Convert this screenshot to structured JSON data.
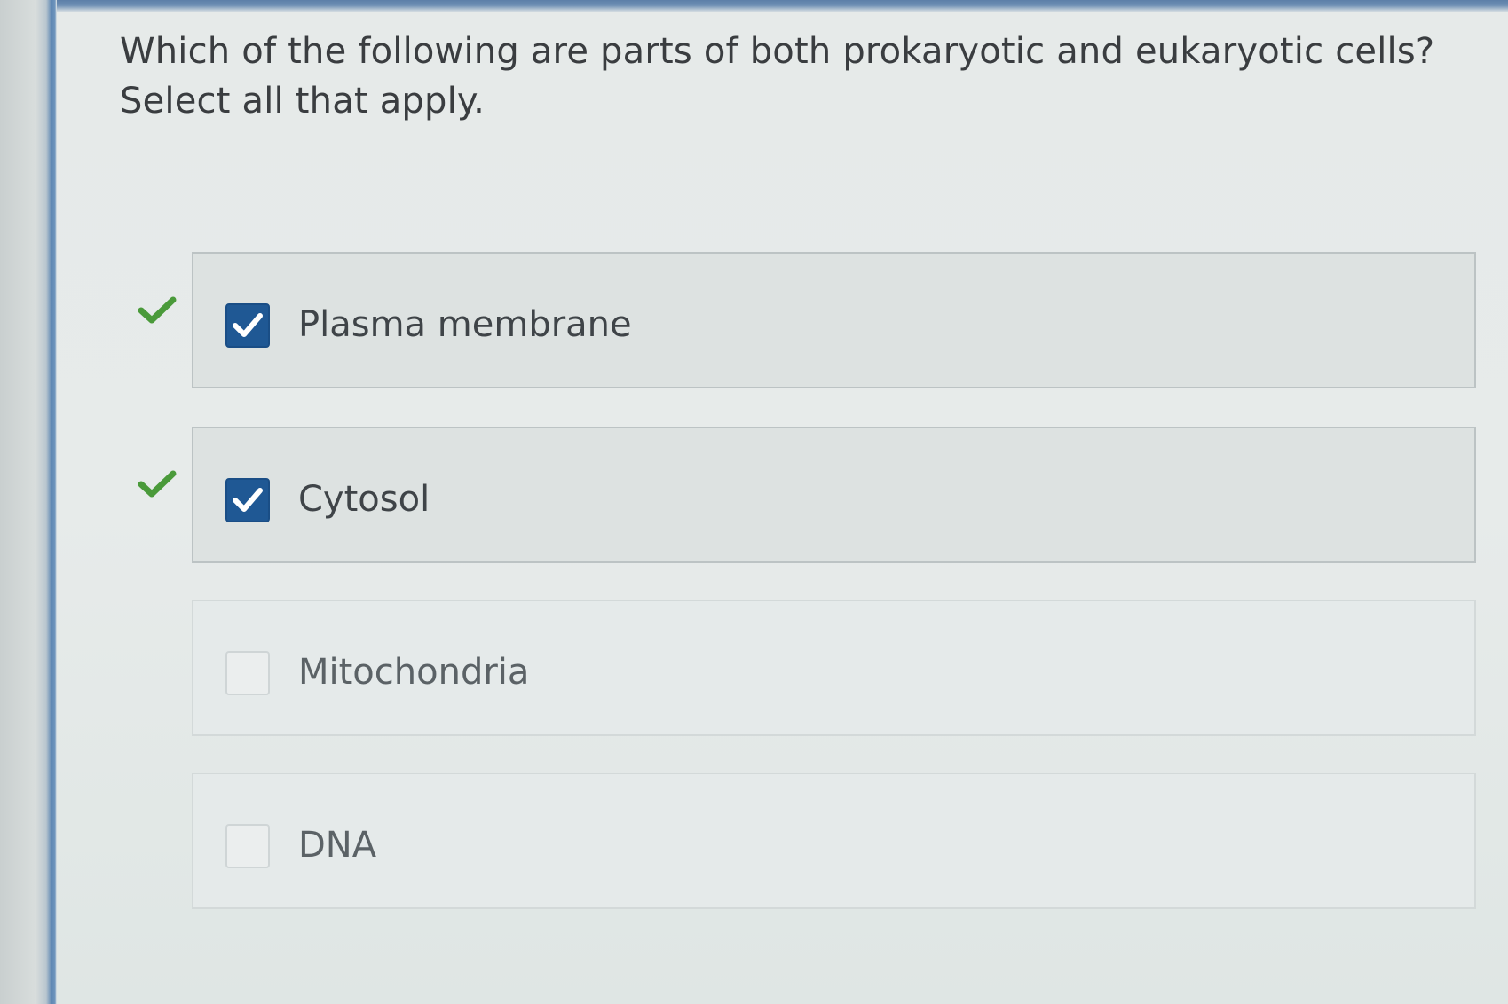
{
  "question": {
    "text": "Which of the following are parts of both prokaryotic and eukaryotic cells? Select all that apply."
  },
  "options": [
    {
      "label": "Plasma membrane",
      "checked": true,
      "marked_correct": true
    },
    {
      "label": "Cytosol",
      "checked": true,
      "marked_correct": true
    },
    {
      "label": "Mitochondria",
      "checked": false,
      "marked_correct": false
    },
    {
      "label": "DNA",
      "checked": false,
      "marked_correct": false
    }
  ],
  "icons": {
    "checkbox_checked": "check-icon",
    "correct_indicator": "green-checkmark-icon"
  },
  "colors": {
    "checkbox_fill": "#1f5894",
    "correct_mark": "#4a9a3a",
    "text": "#3a3d40"
  }
}
